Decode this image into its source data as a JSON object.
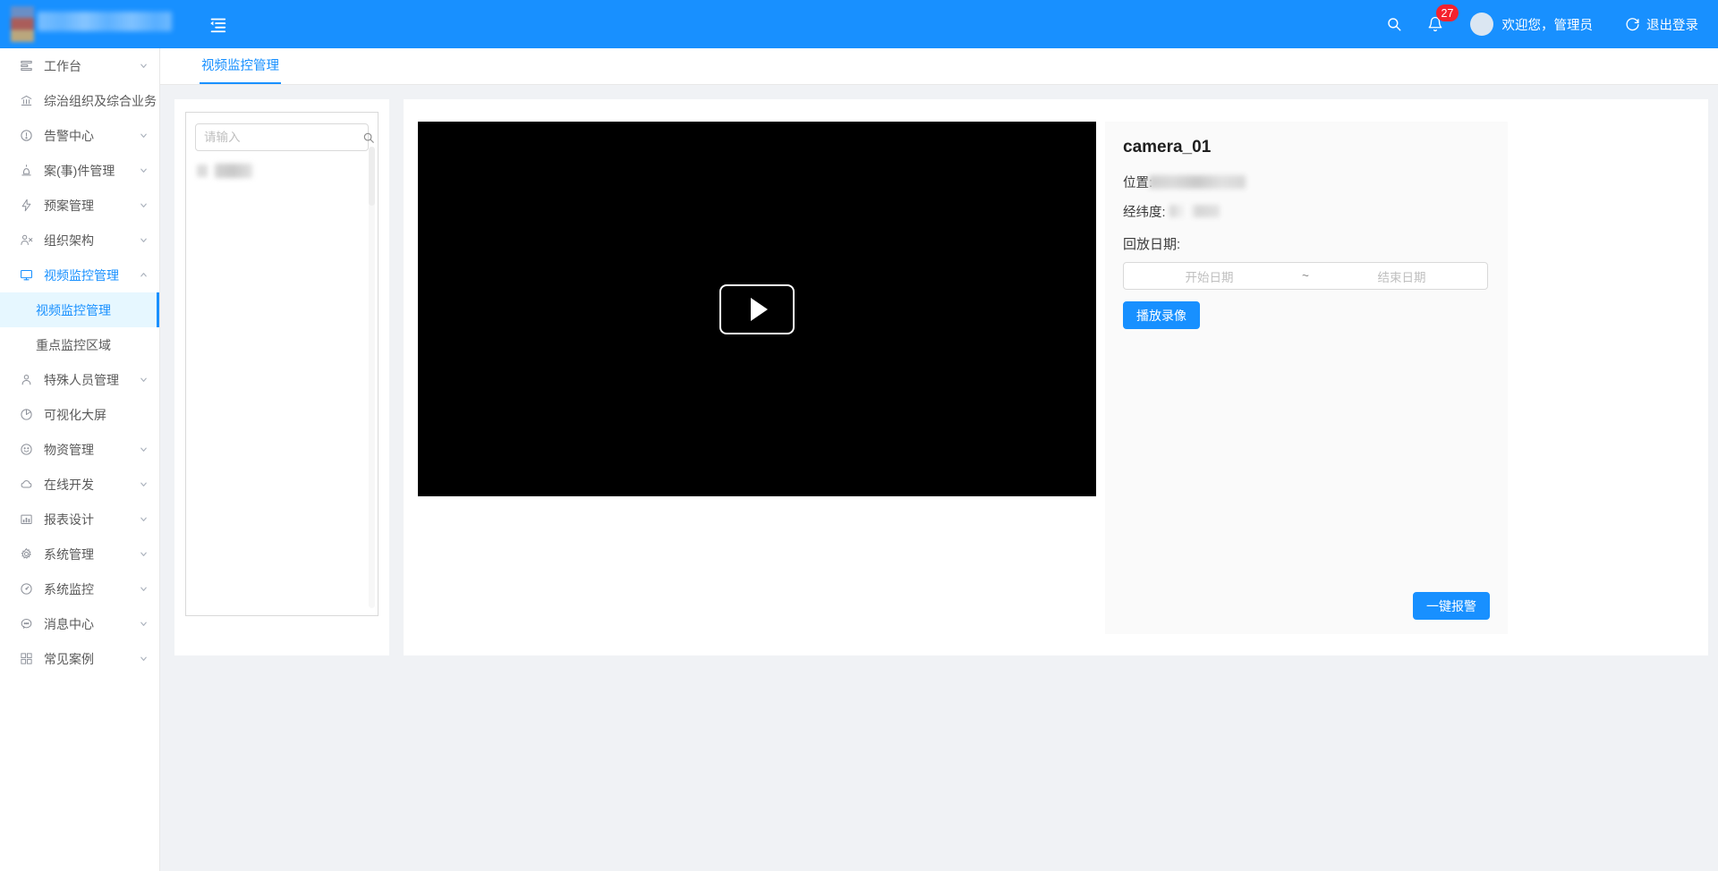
{
  "header": {
    "logo_redacted": true,
    "collapse_icon": "menu-fold-icon",
    "search_icon": "search-icon",
    "bell_icon": "bell-icon",
    "notification_count": "27",
    "avatar_icon": "avatar",
    "welcome": "欢迎您，管理员",
    "logout_icon": "logout-icon",
    "logout_label": "退出登录",
    "background_color": "#1890ff"
  },
  "sidebar": {
    "items": [
      {
        "label": "工作台",
        "icon": "dashboard-icon",
        "expandable": true,
        "active": false
      },
      {
        "label": "综治组织及综合业务",
        "icon": "bank-icon",
        "expandable": true,
        "active": false
      },
      {
        "label": "告警中心",
        "icon": "exclamation-circle-icon",
        "expandable": true,
        "active": false
      },
      {
        "label": "案(事)件管理",
        "icon": "alarm-lamp-icon",
        "expandable": true,
        "active": false
      },
      {
        "label": "预案管理",
        "icon": "thunderbolt-icon",
        "expandable": true,
        "active": false
      },
      {
        "label": "组织架构",
        "icon": "team-icon",
        "expandable": true,
        "active": false
      },
      {
        "label": "视频监控管理",
        "icon": "desktop-icon",
        "expandable": true,
        "active": true
      }
    ],
    "sub_items": [
      {
        "label": "视频监控管理",
        "selected": true
      },
      {
        "label": "重点监控区域",
        "selected": false
      }
    ],
    "items_after": [
      {
        "label": "特殊人员管理",
        "icon": "user-icon",
        "expandable": true,
        "active": false
      },
      {
        "label": "可视化大屏",
        "icon": "pie-chart-icon",
        "expandable": false,
        "active": false
      },
      {
        "label": "物资管理",
        "icon": "smile-icon",
        "expandable": true,
        "active": false
      },
      {
        "label": "在线开发",
        "icon": "cloud-icon",
        "expandable": true,
        "active": false
      },
      {
        "label": "报表设计",
        "icon": "bar-chart-icon",
        "expandable": true,
        "active": false
      },
      {
        "label": "系统管理",
        "icon": "setting-icon",
        "expandable": true,
        "active": false
      },
      {
        "label": "系统监控",
        "icon": "dashboard-gauge-icon",
        "expandable": true,
        "active": false
      },
      {
        "label": "消息中心",
        "icon": "message-icon",
        "expandable": true,
        "active": false
      },
      {
        "label": "常见案例",
        "icon": "appstore-icon",
        "expandable": true,
        "active": false
      }
    ]
  },
  "tabs": [
    {
      "label": "视频监控管理",
      "active": true
    }
  ],
  "tree_panel": {
    "search_placeholder": "请输入",
    "search_value": "",
    "search_icon": "search-icon",
    "nodes": [
      {
        "label": "",
        "redacted": true
      }
    ]
  },
  "player": {
    "play_icon": "play-icon",
    "state": "paused",
    "background_color": "#000000"
  },
  "info_panel": {
    "camera_name": "camera_01",
    "location_label": "位置:",
    "location_value_redacted": true,
    "coordinates_label": "经纬度:",
    "coordinates_value_redacted": true,
    "playback_label": "回放日期:",
    "date_start_placeholder": "开始日期",
    "date_separator": "~",
    "date_end_placeholder": "结束日期",
    "date_start_value": "",
    "date_end_value": "",
    "play_record_label": "播放录像",
    "alarm_label": "一键报警",
    "accent_color": "#1890ff",
    "panel_background": "#fafafa"
  }
}
